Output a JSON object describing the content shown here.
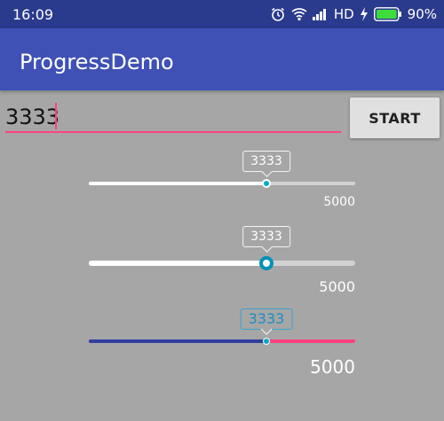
{
  "status_bar": {
    "time": "16:09",
    "network": "HD",
    "battery_percent": "90%",
    "battery_level": 0.9,
    "icons": [
      "alarm-icon",
      "wifi-icon",
      "signal-icon",
      "charging-icon",
      "battery-icon"
    ]
  },
  "app_bar": {
    "title": "ProgressDemo"
  },
  "input": {
    "value": "3333"
  },
  "start_button": {
    "label": "START"
  },
  "colors": {
    "primary_dark": "#2a3a8c",
    "primary": "#3f51b5",
    "accent": "#ff4081",
    "thumb_accent": "#00aac8",
    "background": "#a6a6a6"
  },
  "sliders": [
    {
      "progress": 3333,
      "max": 5000,
      "progress_label": "3333",
      "max_label": "5000",
      "fraction": 0.6666
    },
    {
      "progress": 3333,
      "max": 5000,
      "progress_label": "3333",
      "max_label": "5000",
      "fraction": 0.6666
    },
    {
      "progress": 3333,
      "max": 5000,
      "progress_label": "3333",
      "max_label": "5000",
      "fraction": 0.6666
    }
  ]
}
